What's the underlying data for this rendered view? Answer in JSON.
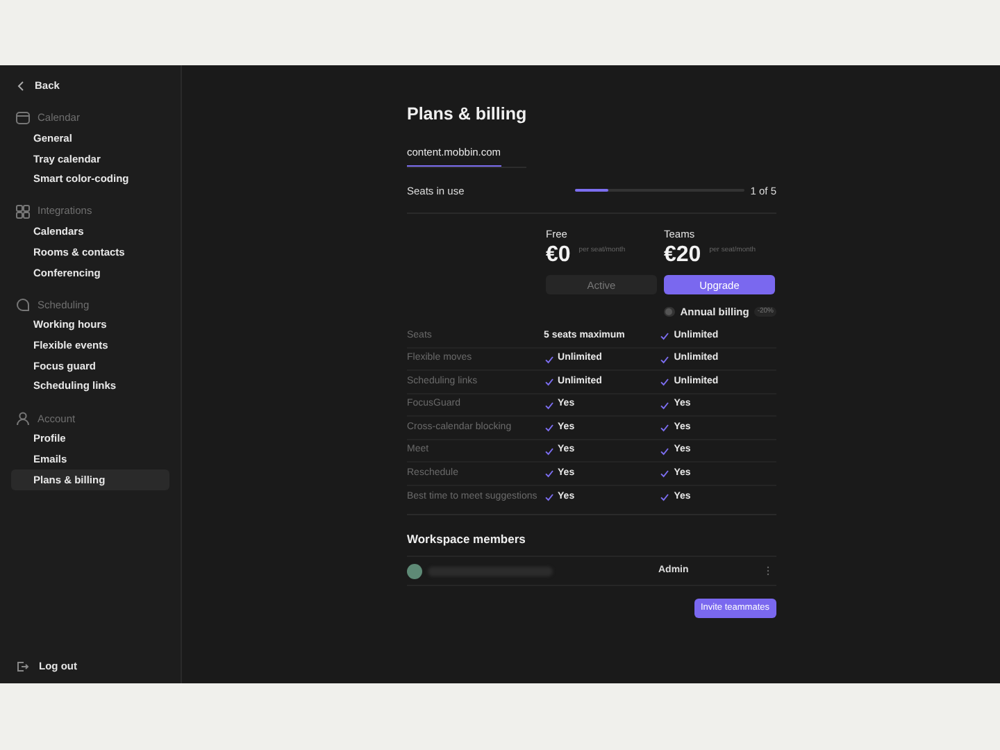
{
  "sidebar": {
    "back": "Back",
    "sections": [
      {
        "title": "Calendar",
        "items": [
          {
            "label": "General",
            "selected": false
          },
          {
            "label": "Tray calendar",
            "selected": false
          },
          {
            "label": "Smart color-coding",
            "selected": false
          }
        ]
      },
      {
        "title": "Integrations",
        "items": [
          {
            "label": "Calendars",
            "selected": false
          },
          {
            "label": "Rooms & contacts",
            "selected": false
          },
          {
            "label": "Conferencing",
            "selected": false
          }
        ]
      },
      {
        "title": "Scheduling",
        "items": [
          {
            "label": "Working hours",
            "selected": false
          },
          {
            "label": "Flexible events",
            "selected": false
          },
          {
            "label": "Focus guard",
            "selected": false
          },
          {
            "label": "Scheduling links",
            "selected": false
          }
        ]
      },
      {
        "title": "Account",
        "items": [
          {
            "label": "Profile",
            "selected": false
          },
          {
            "label": "Emails",
            "selected": false
          },
          {
            "label": "Plans & billing",
            "selected": true
          }
        ]
      }
    ],
    "logout": "Log out"
  },
  "page": {
    "title": "Plans & billing",
    "tabs": [
      {
        "label": "content.mobbin.com",
        "selected": true
      }
    ],
    "seats": {
      "label": "Seats in use",
      "level": 0.2,
      "reading": "1 of 5"
    },
    "plans": [
      {
        "name": "Free",
        "price": "€0",
        "unit": "per seat/month",
        "button": "Active",
        "primary": false
      },
      {
        "name": "Teams",
        "price": "€20",
        "unit": "per seat/month",
        "button": "Upgrade",
        "primary": true
      }
    ],
    "annual_billing": {
      "label": "Annual billing",
      "on": false,
      "badge": "-20%"
    },
    "features": [
      {
        "label": "Seats",
        "cells": [
          {
            "text": "5 seats maximum",
            "check": false
          },
          {
            "text": "Unlimited",
            "check": true
          }
        ]
      },
      {
        "label": "Flexible moves",
        "cells": [
          {
            "text": "Unlimited",
            "check": true
          },
          {
            "text": "Unlimited",
            "check": true
          }
        ]
      },
      {
        "label": "Scheduling links",
        "cells": [
          {
            "text": "Unlimited",
            "check": true
          },
          {
            "text": "Unlimited",
            "check": true
          }
        ]
      },
      {
        "label": "FocusGuard",
        "cells": [
          {
            "text": "Yes",
            "check": true
          },
          {
            "text": "Yes",
            "check": true
          }
        ]
      },
      {
        "label": "Cross-calendar blocking",
        "cells": [
          {
            "text": "Yes",
            "check": true
          },
          {
            "text": "Yes",
            "check": true
          }
        ]
      },
      {
        "label": "Meet",
        "cells": [
          {
            "text": "Yes",
            "check": true
          },
          {
            "text": "Yes",
            "check": true
          }
        ]
      },
      {
        "label": "Reschedule",
        "cells": [
          {
            "text": "Yes",
            "check": true
          },
          {
            "text": "Yes",
            "check": true
          }
        ]
      },
      {
        "label": "Best time to meet suggestions",
        "cells": [
          {
            "text": "Yes",
            "check": true
          },
          {
            "text": "Yes",
            "check": true
          }
        ]
      }
    ],
    "members": {
      "title": "Workspace members",
      "rows": [
        {
          "color": "#5e8a76",
          "role": "Admin"
        }
      ],
      "invite": "Invite teammates"
    }
  }
}
